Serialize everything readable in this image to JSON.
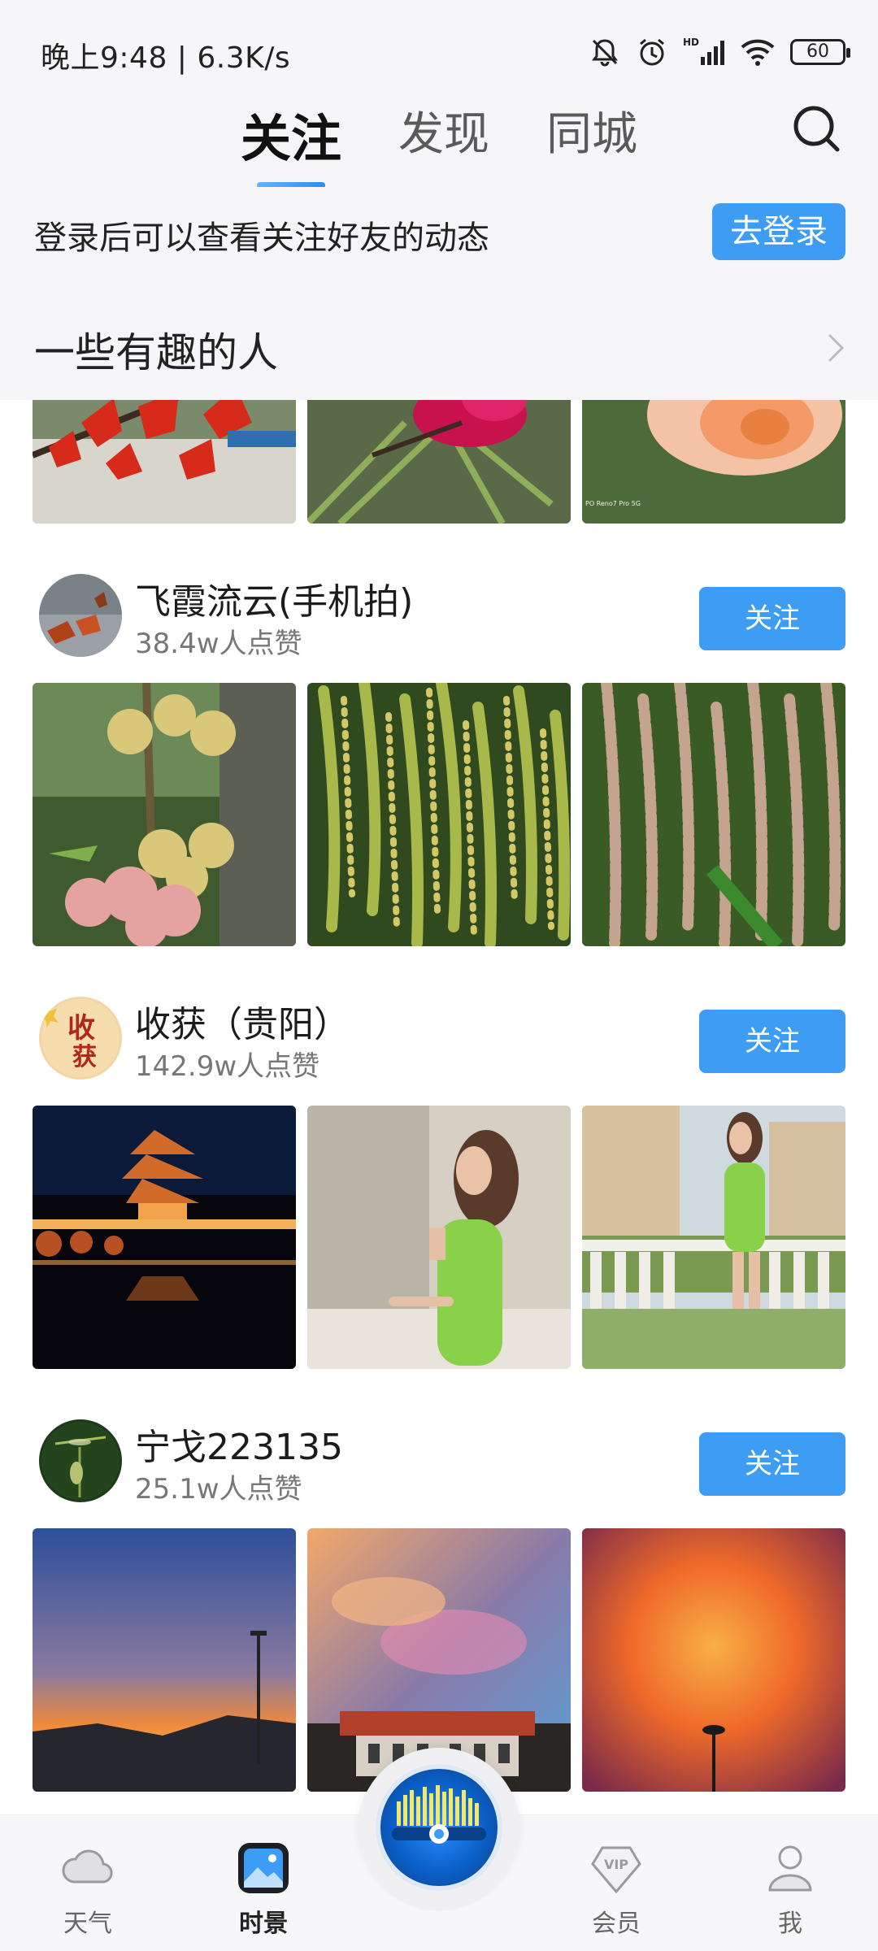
{
  "status_bar": {
    "time_speed": "晚上9:48 | 6.3K/s",
    "battery": "60"
  },
  "header": {
    "tabs": [
      {
        "label": "关注",
        "active": true
      },
      {
        "label": "发现",
        "active": false
      },
      {
        "label": "同城",
        "active": false
      }
    ]
  },
  "login": {
    "prompt": "登录后可以查看关注好友的动态",
    "button": "去登录"
  },
  "section": {
    "title": "一些有趣的人"
  },
  "users": [
    {
      "name": "飞霞流云(手机拍)",
      "likes": "38.4w人点赞",
      "follow_label": "关注"
    },
    {
      "name": "收获（贵阳）",
      "likes": "142.9w人点赞",
      "follow_label": "关注"
    },
    {
      "name": "宁戈223135",
      "likes": "25.1w人点赞",
      "follow_label": "关注"
    }
  ],
  "bottom_nav": [
    {
      "label": "天气",
      "icon": "cloud-icon"
    },
    {
      "label": "时景",
      "icon": "picture-icon",
      "active": true
    },
    {
      "label": "会员",
      "icon": "vip-icon"
    },
    {
      "label": "我",
      "icon": "person-icon"
    }
  ],
  "colors": {
    "accent": "#3d9df5",
    "background": "#f6f6f8"
  }
}
